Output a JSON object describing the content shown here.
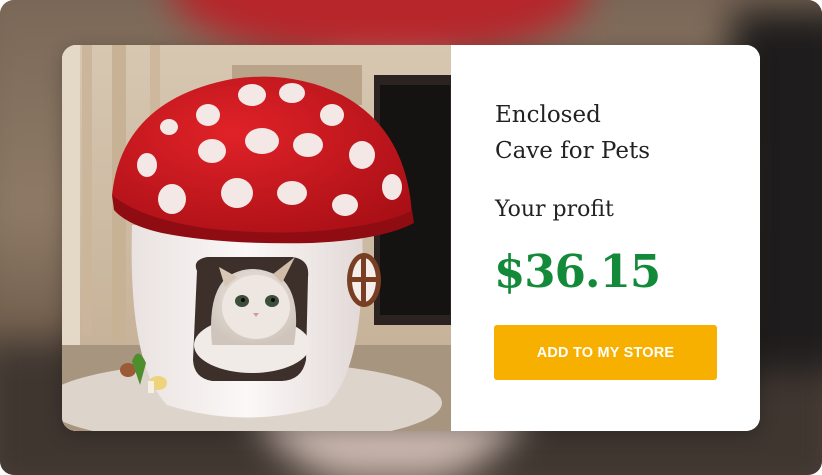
{
  "product": {
    "title_line1": "Enclosed",
    "title_line2": "Cave for Pets",
    "profit_label": "Your profit",
    "profit_value": "$36.15",
    "cta_label": "ADD TO MY STORE"
  },
  "colors": {
    "price_green": "#138a3a",
    "cta_orange": "#f8b000",
    "mushroom_red": "#c8151c"
  }
}
